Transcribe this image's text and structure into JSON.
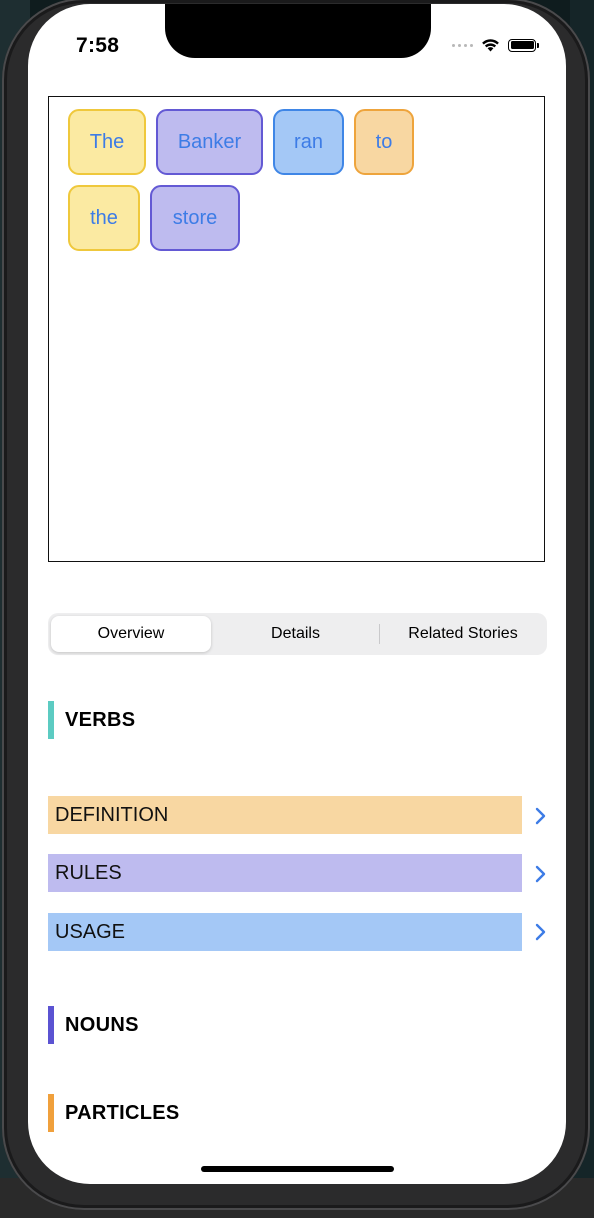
{
  "status_bar": {
    "time": "7:58"
  },
  "sentence": {
    "words": [
      {
        "text": "The",
        "color": "yellow"
      },
      {
        "text": "Banker",
        "color": "purple"
      },
      {
        "text": "ran",
        "color": "blue"
      },
      {
        "text": "to",
        "color": "orange"
      },
      {
        "text": "the",
        "color": "yellow"
      },
      {
        "text": "store",
        "color": "purple"
      }
    ]
  },
  "tabs": {
    "items": [
      "Overview",
      "Details",
      "Related Stories"
    ],
    "selected": "Overview"
  },
  "sections": [
    {
      "title": "VERBS",
      "color": "#5ccbc2"
    },
    {
      "title": "NOUNS",
      "color": "#5b53d2"
    },
    {
      "title": "PARTICLES",
      "color": "#f0a03c"
    }
  ],
  "verb_details": [
    {
      "label": "DEFINITION",
      "color": "#f8d7a2"
    },
    {
      "label": "RULES",
      "color": "#bebbef"
    },
    {
      "label": "USAGE",
      "color": "#a4c8f6"
    }
  ],
  "colors": {
    "accent": "#3d7ce6",
    "chip_yellow": "#fbeaa2",
    "chip_purple": "#bebbef",
    "chip_blue": "#a4c8f6",
    "chip_orange": "#f8d7a2"
  }
}
